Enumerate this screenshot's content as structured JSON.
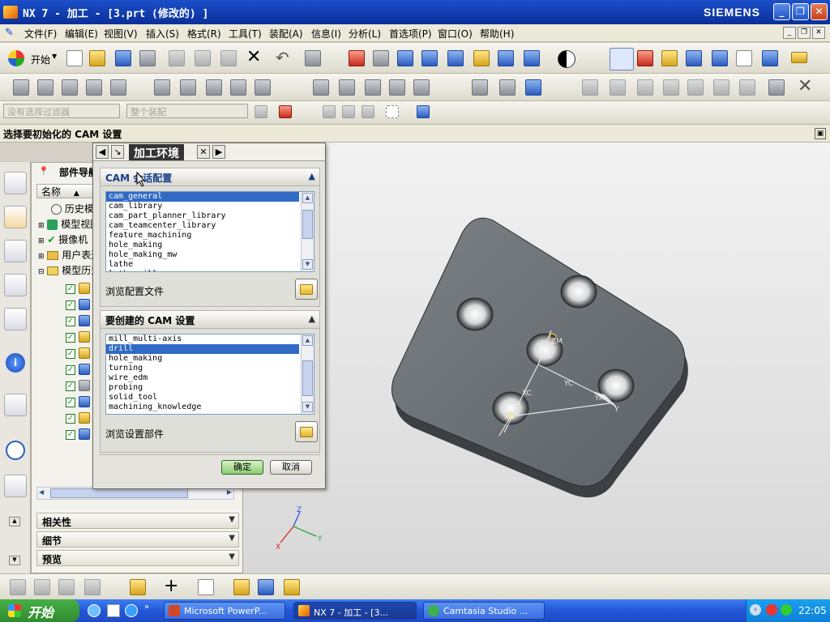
{
  "window": {
    "title": "NX 7 - 加工 - [3.prt (修改的) ]",
    "brand": "SIEMENS"
  },
  "menu": {
    "items": [
      "文件(F)",
      "编辑(E)",
      "视图(V)",
      "插入(S)",
      "格式(R)",
      "工具(T)",
      "装配(A)",
      "信息(I)",
      "分析(L)",
      "首选项(P)",
      "窗口(O)",
      "帮助(H)"
    ]
  },
  "toolbar": {
    "start_label": "开始",
    "filter_placeholder": "没有选择过滤器",
    "assembly_placeholder": "整个装配"
  },
  "cue": {
    "text": "选择要初始化的 CAM 设置"
  },
  "navigator": {
    "title": "部件导航器",
    "column_name": "名称",
    "items": [
      "历史模式",
      "模型视图",
      "摄像机",
      "用户表达式",
      "模型历史记录"
    ],
    "sections": [
      "相关性",
      "细节",
      "预览"
    ]
  },
  "dialog": {
    "title": "加工环境",
    "group1_title": "CAM 会话配置",
    "configs": [
      "cam_general",
      "cam_library",
      "cam_part_planner_library",
      "cam_teamcenter_library",
      "feature_machining",
      "hole_making",
      "hole_making_mw",
      "lathe",
      "lathe_mill"
    ],
    "selected_config": "cam_general",
    "browse_config_label": "浏览配置文件",
    "group2_title": "要创建的 CAM 设置",
    "setups": [
      "mill_multi-axis",
      "drill",
      "hole_making",
      "turning",
      "wire_edm",
      "probing",
      "solid_tool",
      "machining_knowledge"
    ],
    "selected_setup": "drill",
    "browse_setup_label": "浏览设置部件",
    "ok_label": "确定",
    "cancel_label": "取消"
  },
  "viewport": {
    "axis_labels": {
      "zm": "ZM",
      "zc": "ZC",
      "yc": "YC",
      "xc": "XC",
      "xm": "XM",
      "ym": "YM",
      "y": "Y",
      "x": "X",
      "z": "Z"
    }
  },
  "taskbar": {
    "start": "开始",
    "tasks": [
      "Microsoft PowerP...",
      "NX 7 - 加工 - [3...",
      "Camtasia Studio ..."
    ],
    "clock": "22:05"
  },
  "colors": {
    "title_blue": "#0a2f9a",
    "selection": "#316ac5",
    "part_gray": "#6f7478",
    "taskbar": "#2257d8"
  }
}
